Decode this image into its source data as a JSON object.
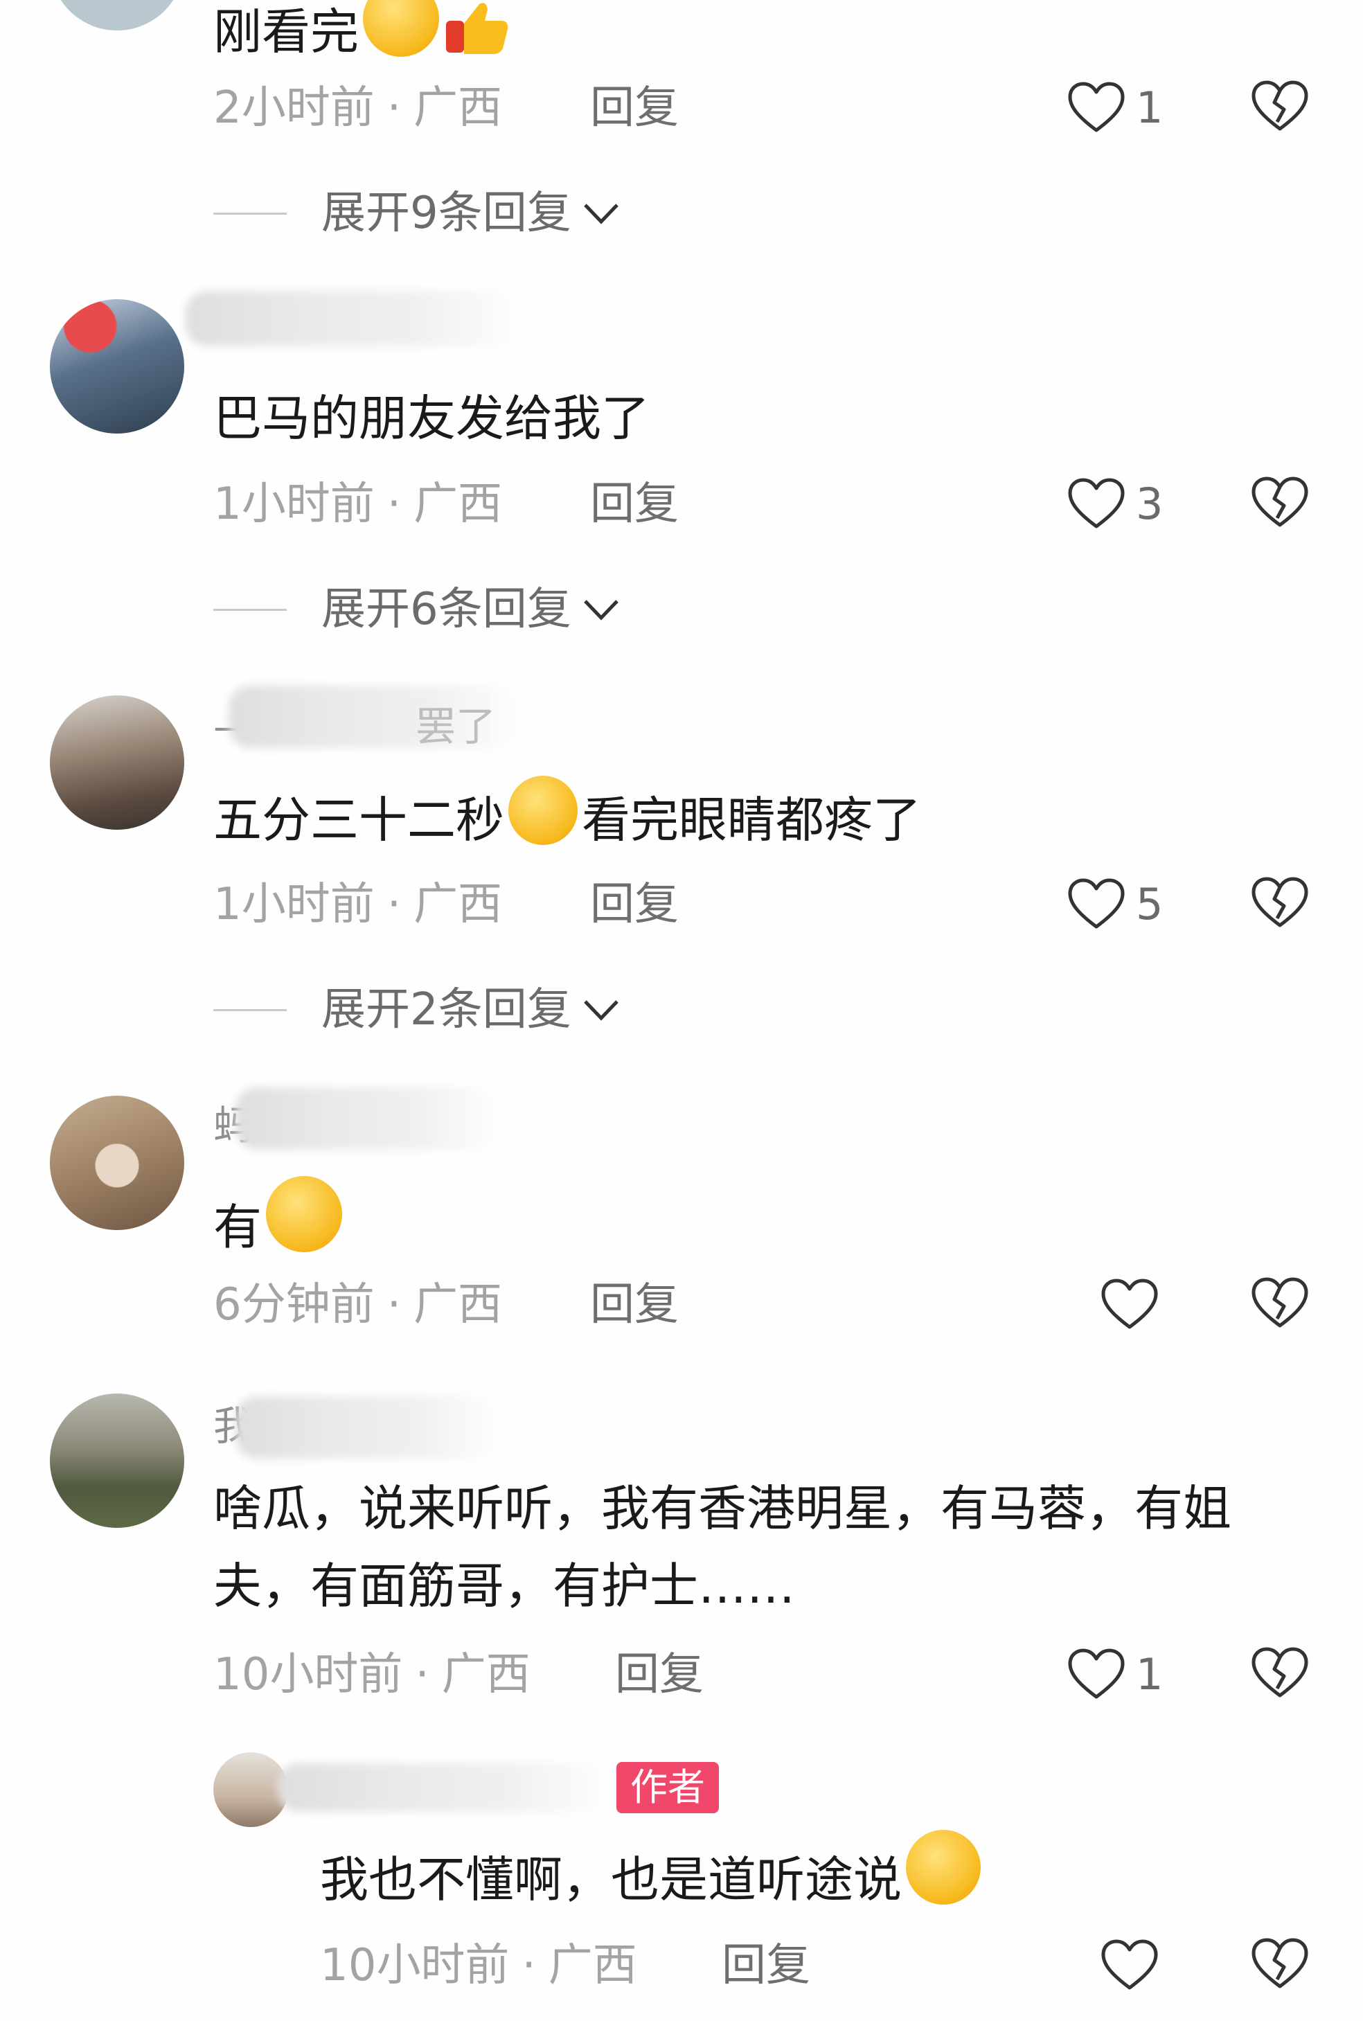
{
  "comments": [
    {
      "text": "刚看完",
      "emoji_after_text": [
        "laughing-crying-emoji",
        "thumbs-up-emoji"
      ],
      "time": "2小时前",
      "location": "广西",
      "reply_label": "回复",
      "likes": "1",
      "expand_label": "展开9条回复"
    },
    {
      "text": "巴马的朋友发给我了",
      "time": "1小时前",
      "location": "广西",
      "reply_label": "回复",
      "likes": "3",
      "expand_label": "展开6条回复"
    },
    {
      "name_fragment": "—",
      "name_fragment_2": "罢了",
      "text_before_emoji": "五分三十二秒",
      "emoji": "crying-emoji",
      "text_after_emoji": "看完眼睛都疼了",
      "time": "1小时前",
      "location": "广西",
      "reply_label": "回复",
      "likes": "5",
      "expand_label": "展开2条回复"
    },
    {
      "name_fragment": "蚂",
      "text": "有",
      "emoji": "surprised-emoji",
      "time": "6分钟前",
      "location": "广西",
      "reply_label": "回复",
      "likes": ""
    },
    {
      "name_fragment": "我",
      "text": "啥瓜，说来听听，我有香港明星，有马蓉，有姐夫，有面筋哥，有护士……",
      "time": "10小时前",
      "location": "广西",
      "reply_label": "回复",
      "likes": "1",
      "reply": {
        "author_tag": "作者",
        "text": "我也不懂啊，也是道听途说",
        "emoji": "grinning-emoji",
        "time": "10小时前",
        "location": "广西",
        "reply_label": "回复",
        "likes": ""
      }
    }
  ],
  "separator": "·",
  "colors": {
    "author_tag": "#f0476a",
    "meta_text": "#a3a3a3",
    "body_text": "#1a1a1a"
  }
}
